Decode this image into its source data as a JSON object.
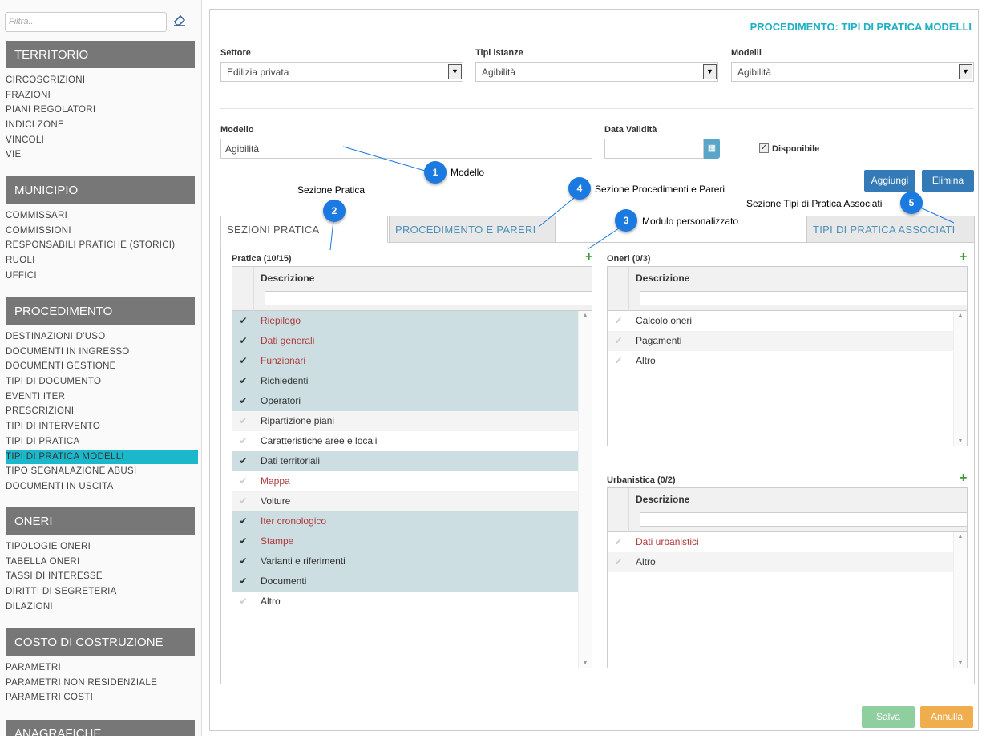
{
  "sidebar": {
    "filter_placeholder": "Filtra...",
    "sections": [
      {
        "title": "TERRITORIO",
        "items": [
          "CIRCOSCRIZIONI",
          "FRAZIONI",
          "PIANI REGOLATORI",
          "INDICI ZONE",
          "VINCOLI",
          "VIE"
        ]
      },
      {
        "title": "MUNICIPIO",
        "items": [
          "COMMISSARI",
          "COMMISSIONI",
          "RESPONSABILI PRATICHE (STORICI)",
          "RUOLI",
          "UFFICI"
        ]
      },
      {
        "title": "PROCEDIMENTO",
        "items": [
          "DESTINAZIONI D'USO",
          "DOCUMENTI IN INGRESSO",
          "DOCUMENTI GESTIONE",
          "TIPI DI DOCUMENTO",
          "EVENTI ITER",
          "PRESCRIZIONI",
          "TIPI DI INTERVENTO",
          "TIPI DI PRATICA",
          "TIPI DI PRATICA MODELLI",
          "TIPO SEGNALAZIONE ABUSI",
          "DOCUMENTI IN USCITA"
        ]
      },
      {
        "title": "ONERI",
        "items": [
          "TIPOLOGIE ONERI",
          "TABELLA ONERI",
          "TASSI DI INTERESSE",
          "DIRITTI DI SEGRETERIA",
          "DILAZIONI"
        ]
      },
      {
        "title": "COSTO DI COSTRUZIONE",
        "items": [
          "PARAMETRI",
          "PARAMETRI NON RESIDENZIALE",
          "PARAMETRI COSTI"
        ]
      },
      {
        "title": "ANAGRAFICHE",
        "items": []
      }
    ],
    "active_item": "TIPI DI PRATICA MODELLI"
  },
  "header": {
    "title": "PROCEDIMENTO: TIPI DI PRATICA MODELLI"
  },
  "filters": {
    "settore_label": "Settore",
    "settore_value": "Edilizia privata",
    "tipi_label": "Tipi istanze",
    "tipi_value": "Agibilità",
    "modelli_label": "Modelli",
    "modelli_value": "Agibilità"
  },
  "form": {
    "modello_label": "Modello",
    "modello_value": "Agibilità",
    "data_label": "Data Validità",
    "data_value": "",
    "disponibile_label": "Disponibile",
    "disponibile_checked": true,
    "aggiungi": "Aggiungi",
    "elimina": "Elimina"
  },
  "tabs": [
    "SEZIONI PRATICA",
    "PROCEDIMENTO E PARERI",
    "TIPI DI PRATICA ASSOCIATI"
  ],
  "pratica": {
    "title": "Pratica (10/15)",
    "header": "Descrizione",
    "rows": [
      {
        "label": "Riepilogo",
        "checked": true,
        "red": true
      },
      {
        "label": "Dati generali",
        "checked": true,
        "red": true
      },
      {
        "label": "Funzionari",
        "checked": true,
        "red": true
      },
      {
        "label": "Richiedenti",
        "checked": true,
        "red": false
      },
      {
        "label": "Operatori",
        "checked": true,
        "red": false
      },
      {
        "label": "Ripartizione piani",
        "checked": false,
        "red": false
      },
      {
        "label": "Caratteristiche aree e locali",
        "checked": false,
        "red": false
      },
      {
        "label": "Dati territoriali",
        "checked": true,
        "red": false
      },
      {
        "label": "Mappa",
        "checked": false,
        "red": true
      },
      {
        "label": "Volture",
        "checked": false,
        "red": false
      },
      {
        "label": "Iter cronologico",
        "checked": true,
        "red": true
      },
      {
        "label": "Stampe",
        "checked": true,
        "red": true
      },
      {
        "label": "Varianti e riferimenti",
        "checked": true,
        "red": false
      },
      {
        "label": "Documenti",
        "checked": true,
        "red": false
      },
      {
        "label": "Altro",
        "checked": false,
        "red": false
      }
    ]
  },
  "oneri": {
    "title": "Oneri (0/3)",
    "header": "Descrizione",
    "rows": [
      {
        "label": "Calcolo oneri",
        "checked": false,
        "red": false
      },
      {
        "label": "Pagamenti",
        "checked": false,
        "red": false
      },
      {
        "label": "Altro",
        "checked": false,
        "red": false
      }
    ]
  },
  "urbanistica": {
    "title": "Urbanistica (0/2)",
    "header": "Descrizione",
    "rows": [
      {
        "label": "Dati urbanistici",
        "checked": false,
        "red": true
      },
      {
        "label": "Altro",
        "checked": false,
        "red": false
      }
    ]
  },
  "footer": {
    "salva": "Salva",
    "annulla": "Annulla"
  },
  "callouts": [
    {
      "num": "1",
      "label": "Modello"
    },
    {
      "num": "2",
      "label": "Sezione Pratica"
    },
    {
      "num": "3",
      "label": "Modulo personalizzato"
    },
    {
      "num": "4",
      "label": "Sezione Procedimenti e Pareri"
    },
    {
      "num": "5",
      "label": "Sezione Tipi di Pratica Associati"
    }
  ],
  "colors": {
    "accent": "#1fb1c4",
    "section_head": "#777777",
    "primary_btn": "#337ab7",
    "salva_btn": "#8fcf9f",
    "annulla_btn": "#f0ad4e",
    "red_text": "#b03a3a",
    "callout": "#1a7ae0"
  }
}
